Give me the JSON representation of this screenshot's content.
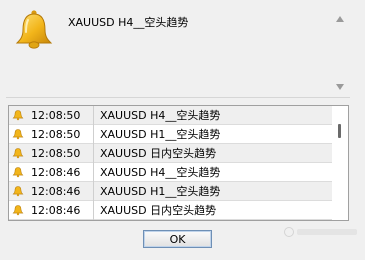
{
  "alert": {
    "message": "XAUUSD H4__空头趋势",
    "icon": "bell-icon"
  },
  "log": {
    "rows": [
      {
        "time": "12:08:50",
        "message": "XAUUSD H4__空头趋势"
      },
      {
        "time": "12:08:50",
        "message": "XAUUSD H1__空头趋势"
      },
      {
        "time": "12:08:50",
        "message": "XAUUSD 日内空头趋势"
      },
      {
        "time": "12:08:46",
        "message": "XAUUSD H4__空头趋势"
      },
      {
        "time": "12:08:46",
        "message": "XAUUSD H1__空头趋势"
      },
      {
        "time": "12:08:46",
        "message": "XAUUSD 日内空头趋势"
      }
    ]
  },
  "buttons": {
    "ok": "OK"
  },
  "colors": {
    "bell": "#f2b51a",
    "window_bg": "#f0f0f0",
    "alt_row": "#efefef"
  }
}
